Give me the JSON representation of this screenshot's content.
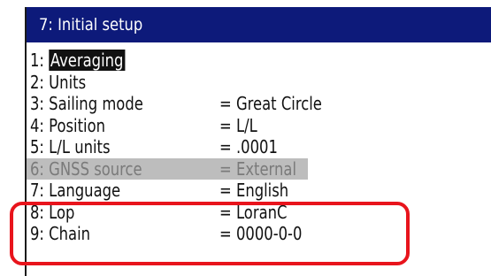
{
  "title": "7: Initial setup",
  "menu": {
    "items": [
      {
        "num": "1:",
        "label": "Averaging",
        "value": "",
        "state": "selected"
      },
      {
        "num": "2:",
        "label": "Units",
        "value": "",
        "state": "normal"
      },
      {
        "num": "3:",
        "label": "Sailing mode",
        "value": "= Great Circle",
        "state": "normal"
      },
      {
        "num": "4:",
        "label": "Position",
        "value": "= L/L",
        "state": "normal"
      },
      {
        "num": "5:",
        "label": "L/L units",
        "value": "= .0001",
        "state": "normal"
      },
      {
        "num": "6:",
        "label": "GNSS source",
        "value": "= External",
        "state": "disabled"
      },
      {
        "num": "7:",
        "label": "Language",
        "value": "= English",
        "state": "normal"
      },
      {
        "num": "8:",
        "label": "Lop",
        "value": "= LoranC",
        "state": "normal"
      },
      {
        "num": "9:",
        "label": "Chain",
        "value": "= 0000-0-0",
        "state": "normal"
      }
    ]
  },
  "colors": {
    "title_bg": "#0d1a7a",
    "title_fg": "#ffffff",
    "selected_bg": "#111111",
    "disabled_bg": "#bdbdbd",
    "annotation": "#e8141c"
  }
}
